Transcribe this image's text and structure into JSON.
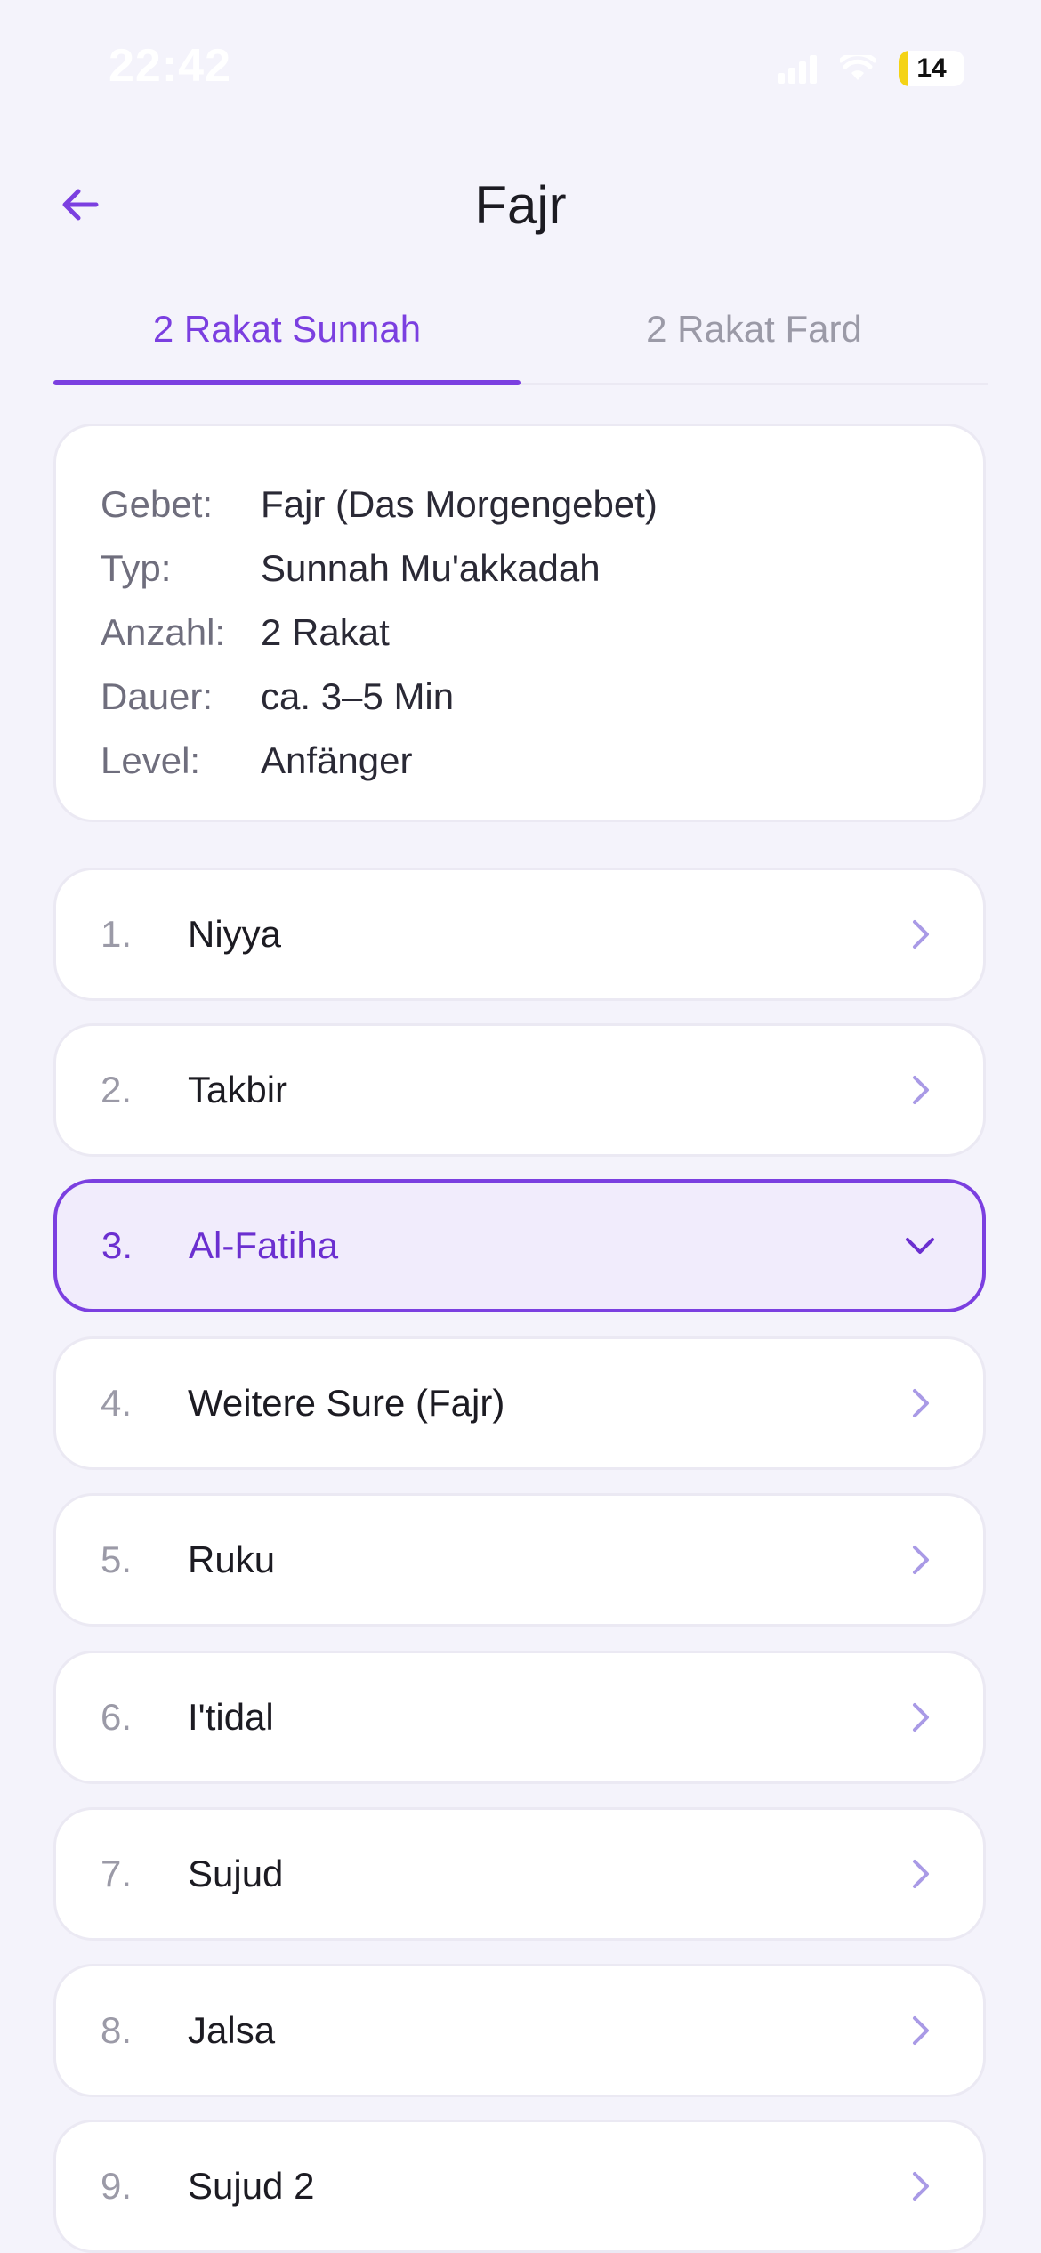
{
  "status_bar": {
    "time": "22:42",
    "battery_level": "14",
    "battery_fraction": 0.14
  },
  "header": {
    "title": "Fajr",
    "back_icon": "arrow-left-icon"
  },
  "tabs": [
    {
      "label": "2 Rakat Sunnah",
      "active": true
    },
    {
      "label": "2 Rakat Fard",
      "active": false
    }
  ],
  "info": [
    {
      "label": "Gebet:",
      "value": "Fajr (Das Morgengebet)"
    },
    {
      "label": "Typ:",
      "value": "Sunnah Mu'akkadah"
    },
    {
      "label": "Anzahl:",
      "value": "2 Rakat"
    },
    {
      "label": "Dauer:",
      "value": "ca. 3–5 Min"
    },
    {
      "label": "Level:",
      "value": "Anfänger"
    }
  ],
  "steps": [
    {
      "number": "1.",
      "label": "Niyya",
      "expanded": false
    },
    {
      "number": "2.",
      "label": "Takbir",
      "expanded": false
    },
    {
      "number": "3.",
      "label": "Al-Fatiha",
      "expanded": true
    },
    {
      "number": "4.",
      "label": "Weitere Sure (Fajr)",
      "expanded": false
    },
    {
      "number": "5.",
      "label": "Ruku",
      "expanded": false
    },
    {
      "number": "6.",
      "label": "I'tidal",
      "expanded": false
    },
    {
      "number": "7.",
      "label": "Sujud",
      "expanded": false
    },
    {
      "number": "8.",
      "label": "Jalsa",
      "expanded": false
    },
    {
      "number": "9.",
      "label": "Sujud 2",
      "expanded": false
    }
  ],
  "colors": {
    "accent": "#7b3fe0",
    "background": "#f4f3fb",
    "card": "#ffffff",
    "battery": "#f4d316"
  }
}
